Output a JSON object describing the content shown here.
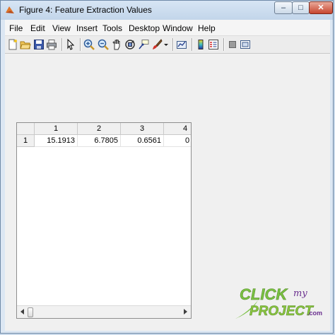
{
  "window": {
    "title": "Figure 4: Feature Extraction Values"
  },
  "controls": {
    "minimize": "–",
    "maximize": "□",
    "close": "✕"
  },
  "menu": [
    "File",
    "Edit",
    "View",
    "Insert",
    "Tools",
    "Desktop",
    "Window",
    "Help"
  ],
  "toolbar": [
    "new-figure-icon",
    "open-file-icon",
    "save-icon",
    "print-icon",
    "pointer-icon",
    "zoom-in-icon",
    "zoom-out-icon",
    "pan-icon",
    "rotate-3d-icon",
    "data-cursor-icon",
    "brush-icon",
    "dropdown-arrow-icon",
    "link-plot-icon",
    "colorbar-icon",
    "legend-icon",
    "hide-plot-tools-icon",
    "show-plot-tools-icon"
  ],
  "table": {
    "columns": [
      "1",
      "2",
      "3",
      "4"
    ],
    "rows": [
      {
        "label": "1",
        "cells": [
          "15.1913",
          "6.7805",
          "0.6561",
          "0"
        ]
      }
    ]
  },
  "watermark": {
    "line1": "CLICK",
    "line2": "my",
    "line3": "PROJECT",
    "suffix": ".com"
  },
  "colors": {
    "accent": "#c7452e",
    "watermark_green": "#7ac143",
    "watermark_purple": "#6a2f8f"
  }
}
